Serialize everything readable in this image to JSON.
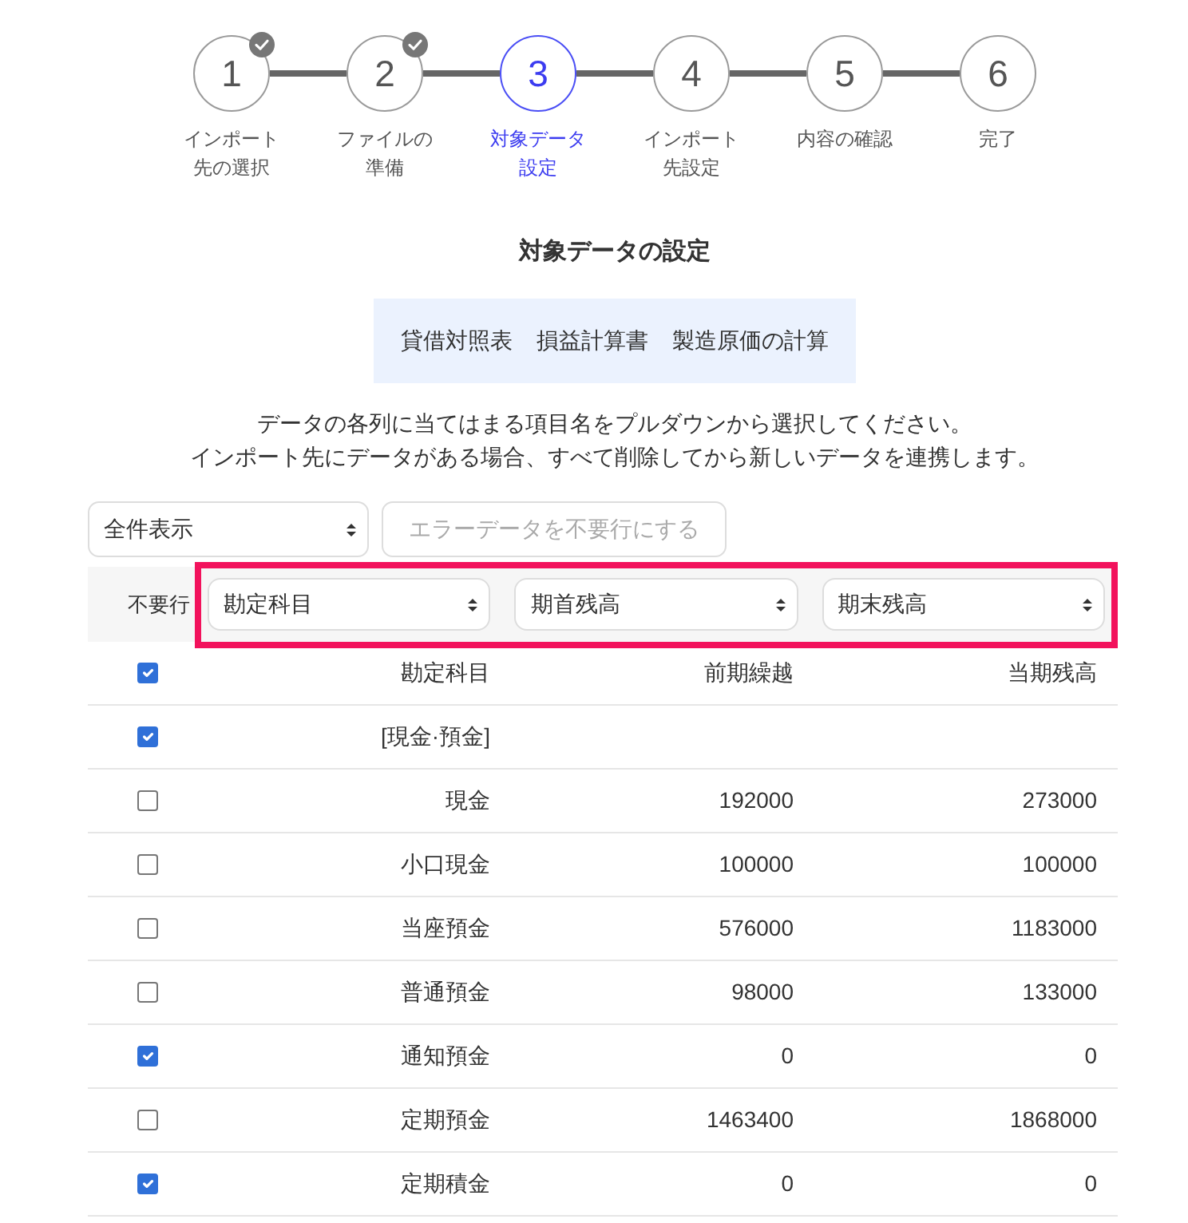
{
  "steps": [
    {
      "number": "1",
      "label": "インポート先の選択",
      "completed": true,
      "selected": false
    },
    {
      "number": "2",
      "label": "ファイルの準備",
      "completed": true,
      "selected": false
    },
    {
      "number": "3",
      "label": "対象データ設定",
      "completed": false,
      "selected": true
    },
    {
      "number": "4",
      "label": "インポート先設定",
      "completed": false,
      "selected": false
    },
    {
      "number": "5",
      "label": "内容の確認",
      "completed": false,
      "selected": false
    },
    {
      "number": "6",
      "label": "完了",
      "completed": false,
      "selected": false
    }
  ],
  "section_title": "対象データの設定",
  "sheets": [
    "貸借対照表",
    "損益計算書",
    "製造原価の計算"
  ],
  "instructions": [
    "データの各列に当てはまる項目名をプルダウンから選択してください。",
    "インポート先にデータがある場合、すべて削除してから新しいデータを連携します。"
  ],
  "toolbar": {
    "filter_select": {
      "value": "全件表示"
    },
    "error_button": {
      "label": "エラーデータを不要行にする",
      "disabled": true
    }
  },
  "table": {
    "skip_column_label": "不要行",
    "mapping": {
      "highlighted": true,
      "selects": [
        {
          "value": "勘定科目"
        },
        {
          "value": "期首残高"
        },
        {
          "value": "期末残高"
        }
      ]
    },
    "rows": [
      {
        "checked": true,
        "cells": [
          "勘定科目",
          "前期繰越",
          "当期残高"
        ]
      },
      {
        "checked": true,
        "cells": [
          "[現金·預金]"
        ]
      },
      {
        "checked": false,
        "cells": [
          "現金",
          "192000",
          "273000"
        ]
      },
      {
        "checked": false,
        "cells": [
          "小口現金",
          "100000",
          "100000"
        ]
      },
      {
        "checked": false,
        "cells": [
          "当座預金",
          "576000",
          "1183000"
        ]
      },
      {
        "checked": false,
        "cells": [
          "普通預金",
          "98000",
          "133000"
        ]
      },
      {
        "checked": true,
        "cells": [
          "通知預金",
          "0",
          "0"
        ]
      },
      {
        "checked": false,
        "cells": [
          "定期預金",
          "1463400",
          "1868000"
        ]
      },
      {
        "checked": true,
        "cells": [
          "定期積金",
          "0",
          "0"
        ]
      }
    ]
  }
}
